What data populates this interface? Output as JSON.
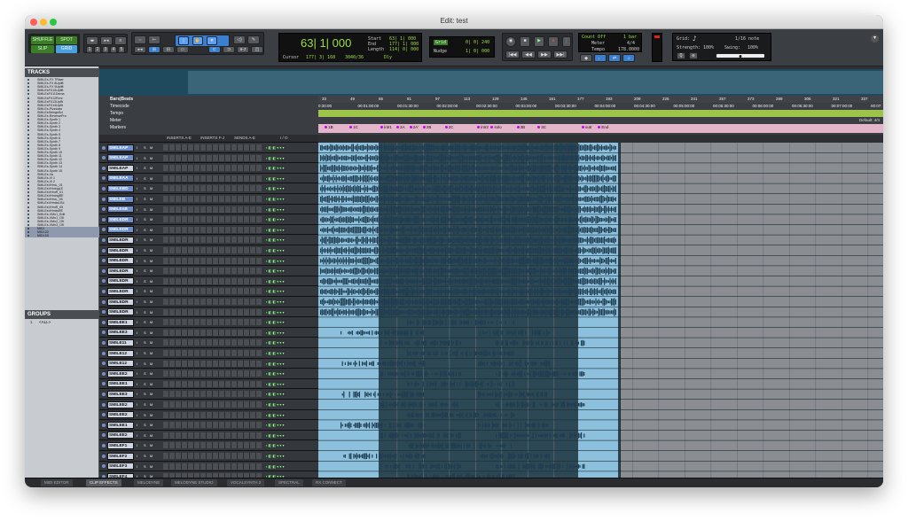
{
  "window": {
    "title": "Edit: test",
    "traffic": {
      "close": "#ff5f57",
      "minimize": "#febc2e",
      "zoom": "#28c840"
    }
  },
  "toolbar": {
    "edit_modes": [
      "SHUFFLE",
      "SPOT",
      "SLIP",
      "GRID"
    ],
    "zoom_presets": [
      "1",
      "2",
      "3",
      "4",
      "5"
    ],
    "counter": {
      "main": "63| 1| 000",
      "start_label": "Start",
      "end_label": "End",
      "length_label": "Length",
      "start": "63| 1| 000",
      "end": "177| 1| 000",
      "length": "114| 0| 000",
      "cursor_label": "Cursor",
      "cursor": "177| 3| 168",
      "value": "3040/36",
      "dly": "Dly"
    },
    "grid": {
      "grid_label": "Grid",
      "grid_value": "0| 0| 240",
      "nudge_label": "Nudge",
      "nudge_value": "1| 0| 000"
    },
    "transport_secondary": [
      "|◀◀",
      "◀◀",
      "▶▶",
      "▶▶|"
    ],
    "meter": {
      "count": "Count Off",
      "bars": "1 bar",
      "meter_label": "Meter",
      "meter_value": "4/4",
      "tempo_label": "Tempo",
      "tempo_value": "178.0000"
    },
    "midi": {
      "grid_label": "Grid:",
      "grid_value": "1/16 note",
      "strength_label": "Strength:",
      "strength_value": "100%",
      "swing_label": "Swing:",
      "swing_value": "100%"
    }
  },
  "panels": {
    "tracks_title": "TRACKS",
    "groups_title": "GROUPS",
    "groups_item": "<ALL>",
    "groups_num": "1"
  },
  "track_list": [
    "SMILEs-FX 7Riser",
    "SMILEs-FX 8Uplift",
    "SMILEs-FX 9Uplift",
    "SMILEsFX10Uplift",
    "SMILEsFX11Dema",
    "SMILEsFX12Rvrc",
    "SMILEsFX13Upfft",
    "SMILEsFX14Upftr",
    "SMILEs-Pizzicato",
    "SMILEsStringsSci",
    "SMILEs-ReversePro",
    "SMILEs-Synth 1",
    "SMILEs-Synth 2",
    "SMILEs-Synth 3",
    "SMILEs-Synth 4",
    "SMILEs-Synth 5",
    "SMILEs-Synth 6",
    "SMILEs-Synth 7",
    "SMILEs-Synth 8",
    "SMILEs-Synth 9",
    "SMILEs-Synth 10",
    "SMILEs-Synth 11",
    "SMILEs-Synth 12",
    "SMILEs-Synth 13",
    "SMILEs-Synth 14",
    "SMILEs-Synth 15",
    "SMILEs-Va",
    "SMILEs-Vl 1",
    "SMILEs-Vl 2",
    "SMILEsVHmL_01",
    "SMILEsVHmhgLE",
    "SMILEsVHmR_01",
    "SMILEsVHmhgRE",
    "SMILEsVHmL_05",
    "SMILEsVHmlwLEd",
    "SMILEsVHmR_05",
    "SMILEsVHmlwRE",
    "SMILEs-VMn1_Edit",
    "SMILEs-VMn1_OK",
    "SMILEs-VMn2_OK",
    "SMILEs-VMn3_OK",
    "MIDI",
    "MIDI-02",
    "MIDI-03"
  ],
  "rulers": {
    "bars_label": "Bars|Beats",
    "timecode_label": "Timecode",
    "tempo_label": "Tempo",
    "meter_label": "Meter",
    "markers_label": "Markers",
    "meter_default": "Default: 4/4",
    "bars": [
      "33",
      "49",
      "65",
      "81",
      "97",
      "113",
      "129",
      "145",
      "161",
      "177",
      "193",
      "209",
      "225",
      "241",
      "257",
      "273",
      "289",
      "305",
      "321",
      "337"
    ],
    "timecode": [
      "0:30:00",
      "00:01:00:00",
      "00:01:30:00",
      "00:02:00:00",
      "00:02:30:00",
      "00:03:00:00",
      "00:03:30:00",
      "00:04:00:00",
      "00:04:30:00",
      "00:05:00:00",
      "00:05:30:00",
      "00:06:00:00",
      "00:06:30:00",
      "00:07:00:00",
      "00:07:"
    ],
    "markers": [
      {
        "label": "1B",
        "x": 0.008
      },
      {
        "label": "1C",
        "x": 0.052
      },
      {
        "label": "intr1",
        "x": 0.107
      },
      {
        "label": "2A",
        "x": 0.135
      },
      {
        "label": "2A'",
        "x": 0.158
      },
      {
        "label": "2B",
        "x": 0.182
      },
      {
        "label": "2C",
        "x": 0.221
      },
      {
        "label": "intr2",
        "x": 0.278
      },
      {
        "label": "solo",
        "x": 0.302
      },
      {
        "label": "3B",
        "x": 0.348
      },
      {
        "label": "3C",
        "x": 0.385
      },
      {
        "label": "outr",
        "x": 0.463
      },
      {
        "label": "End",
        "x": 0.492
      }
    ]
  },
  "columns": {
    "inserts_ae": "INSERTS A-E",
    "inserts_fj": "INSERTS F-J",
    "sends": "SENDS A-E",
    "io": "I / O"
  },
  "track_buttons": {
    "solo": "S",
    "mute": "M",
    "input": "I"
  },
  "tracks": [
    {
      "name": "SMILEAP",
      "blue": true
    },
    {
      "name": "SMILEAP",
      "blue": true
    },
    {
      "name": "SMILEAP",
      "blue": false
    },
    {
      "name": "SMILEAA",
      "blue": true
    },
    {
      "name": "SMILEBD",
      "blue": true
    },
    {
      "name": "SMILEB",
      "blue": true
    },
    {
      "name": "SMILEsB",
      "blue": true
    },
    {
      "name": "SMILEDR",
      "blue": true
    },
    {
      "name": "SMILEDR",
      "blue": true
    },
    {
      "name": "SMILEDR",
      "blue": false
    },
    {
      "name": "SMILEDR",
      "blue": false
    },
    {
      "name": "SMILEDR",
      "blue": false
    },
    {
      "name": "SMILEDR",
      "blue": false
    },
    {
      "name": "SMILEDR",
      "blue": false
    },
    {
      "name": "SMILEDR",
      "blue": false
    },
    {
      "name": "SMILEDR",
      "blue": false
    },
    {
      "name": "SMILEDR",
      "blue": false
    },
    {
      "name": "SMILEE1",
      "blue": false
    },
    {
      "name": "SMILEE3",
      "blue": false
    },
    {
      "name": "SMILE11",
      "blue": false
    },
    {
      "name": "SMILE12",
      "blue": false
    },
    {
      "name": "SMILE12",
      "blue": false
    },
    {
      "name": "SMILEE2",
      "blue": false
    },
    {
      "name": "SMILEE1",
      "blue": false
    },
    {
      "name": "SMILEE3",
      "blue": false
    },
    {
      "name": "SMILEE2",
      "blue": false
    },
    {
      "name": "SMILEE2",
      "blue": false
    },
    {
      "name": "SMILEE1",
      "blue": false
    },
    {
      "name": "SMILEE2",
      "blue": false
    },
    {
      "name": "SMILEF1",
      "blue": false
    },
    {
      "name": "SMILEF2",
      "blue": false
    },
    {
      "name": "SMILEF3",
      "blue": false
    },
    {
      "name": "SMILEF4",
      "blue": false
    }
  ],
  "footer_tabs": [
    "MIDI EDITOR",
    "CLIP EFFECTS",
    "MELODYNE",
    "MELODYNE STUDIO",
    "VOCALSYNTH 2",
    "SPECTRAL",
    "RX CONNECT"
  ],
  "colors": {
    "selection": "#2c4855",
    "clip": "#8cc0dc",
    "waveform": "#1f3c50",
    "ruler_tempo": "#9cc44a",
    "ruler_markers": "#e2b6c8"
  }
}
